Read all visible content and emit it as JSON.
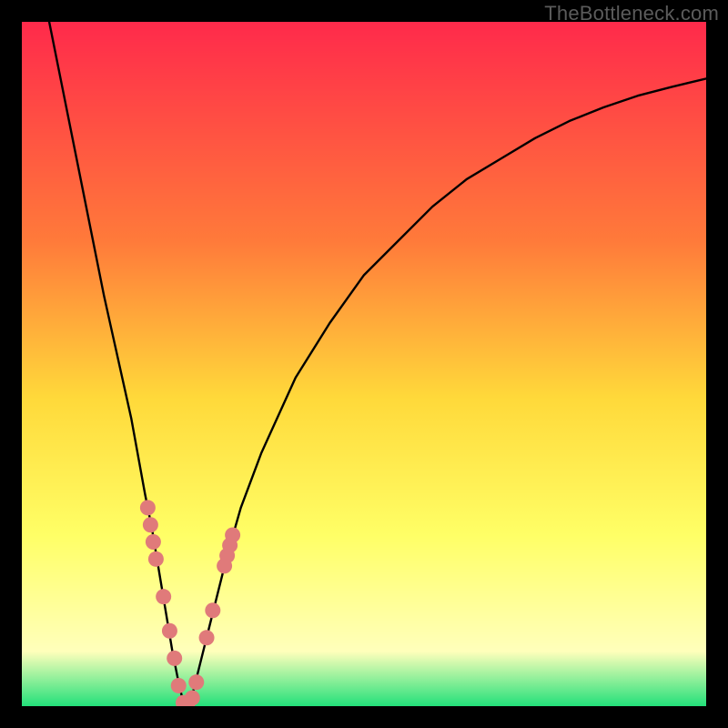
{
  "watermark": "TheBottleneck.com",
  "colors": {
    "frame_bg": "#000000",
    "grad_top": "#ff2a4b",
    "grad_mid1": "#ff7a3a",
    "grad_mid2": "#ffd93a",
    "grad_mid3": "#ffff66",
    "grad_pale": "#ffffbb",
    "grad_bottom": "#23e07a",
    "curve": "#000000",
    "marker_fill": "#e07a7a",
    "marker_stroke": "#c96a6a"
  },
  "chart_data": {
    "type": "line",
    "title": "",
    "xlabel": "",
    "ylabel": "",
    "xlim": [
      0,
      100
    ],
    "ylim": [
      0,
      100
    ],
    "series": [
      {
        "name": "curve",
        "x": [
          4,
          6,
          8,
          10,
          12,
          14,
          16,
          18,
          19,
          20,
          21,
          22,
          23,
          23.5,
          24,
          25,
          26,
          27,
          28,
          30,
          32,
          35,
          40,
          45,
          50,
          55,
          60,
          65,
          70,
          75,
          80,
          85,
          90,
          95,
          100
        ],
        "y": [
          100,
          90,
          80,
          70,
          60,
          51,
          42,
          31,
          26,
          20,
          14,
          8,
          3,
          1,
          0,
          2,
          6,
          10,
          14,
          22,
          29,
          37,
          48,
          56,
          63,
          68,
          73,
          77,
          80,
          83,
          85.5,
          87.5,
          89.2,
          90.5,
          91.7
        ]
      }
    ],
    "markers": [
      {
        "x": 18.4,
        "y": 29.0
      },
      {
        "x": 18.8,
        "y": 26.5
      },
      {
        "x": 19.2,
        "y": 24.0
      },
      {
        "x": 19.6,
        "y": 21.5
      },
      {
        "x": 20.7,
        "y": 16.0
      },
      {
        "x": 21.6,
        "y": 11.0
      },
      {
        "x": 22.3,
        "y": 7.0
      },
      {
        "x": 22.9,
        "y": 3.0
      },
      {
        "x": 23.6,
        "y": 0.5
      },
      {
        "x": 24.2,
        "y": 0.4
      },
      {
        "x": 24.9,
        "y": 1.2
      },
      {
        "x": 25.5,
        "y": 3.5
      },
      {
        "x": 27.0,
        "y": 10.0
      },
      {
        "x": 27.9,
        "y": 14.0
      },
      {
        "x": 29.6,
        "y": 20.5
      },
      {
        "x": 30.0,
        "y": 22.0
      },
      {
        "x": 30.4,
        "y": 23.5
      },
      {
        "x": 30.8,
        "y": 25.0
      }
    ],
    "legend": false,
    "grid": false
  }
}
